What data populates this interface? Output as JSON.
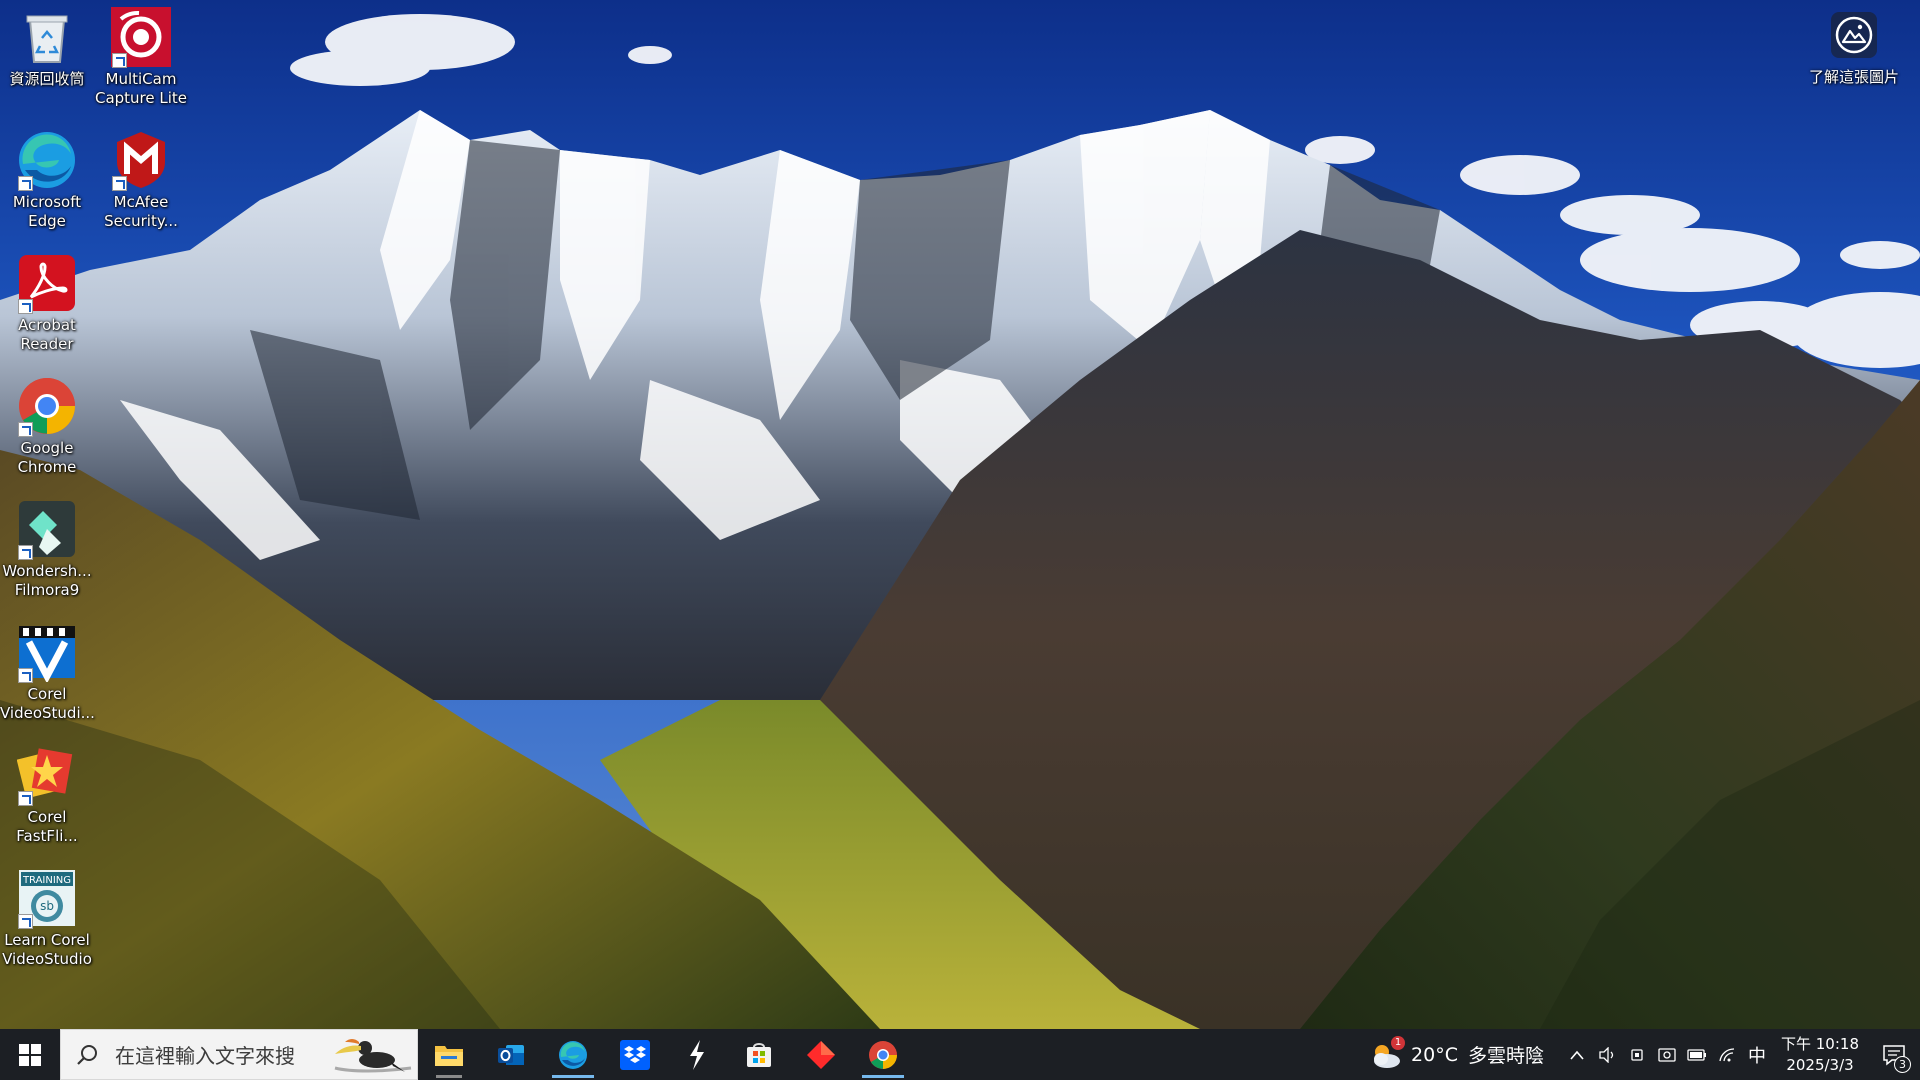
{
  "desktop": {
    "icons": [
      {
        "label": "資源回收筒",
        "icon": "recycle-bin-icon"
      },
      {
        "label": "MultiCam Capture Lite",
        "icon": "multicam-icon"
      },
      {
        "label": "Microsoft Edge",
        "icon": "edge-icon"
      },
      {
        "label": "McAfee Security...",
        "icon": "mcafee-icon"
      },
      {
        "label": "Acrobat Reader",
        "icon": "acrobat-icon"
      },
      {
        "label": "Google Chrome",
        "icon": "chrome-icon"
      },
      {
        "label": "Wondersh... Filmora9",
        "icon": "filmora-icon"
      },
      {
        "label": "Corel VideoStudi...",
        "icon": "corel-videostudio-icon"
      },
      {
        "label": "Corel FastFli...",
        "icon": "corel-fastflick-icon"
      },
      {
        "label": "Learn Corel VideoStudio",
        "icon": "learn-corel-icon"
      }
    ],
    "learn_photo_label": "了解這張圖片"
  },
  "taskbar": {
    "search_placeholder": "在這裡輸入文字來搜",
    "apps": [
      {
        "name": "File Explorer",
        "icon": "folder-icon"
      },
      {
        "name": "Outlook",
        "icon": "outlook-icon"
      },
      {
        "name": "Microsoft Edge",
        "icon": "edge-icon"
      },
      {
        "name": "Dropbox",
        "icon": "dropbox-icon"
      },
      {
        "name": "App",
        "icon": "bolt-icon"
      },
      {
        "name": "Microsoft Store",
        "icon": "store-icon"
      },
      {
        "name": "App",
        "icon": "red-diamond-icon"
      },
      {
        "name": "Google Chrome",
        "icon": "chrome-icon"
      }
    ],
    "weather": {
      "temp": "20°C",
      "condition": "多雲時陰",
      "alert": "1"
    },
    "ime": "中",
    "clock": {
      "time": "下午 10:18",
      "date": "2025/3/3"
    },
    "notifications": "3"
  },
  "colors": {
    "taskbar": "#1c1f24",
    "sky": "#1646a8",
    "accent": "#76b9ed"
  }
}
